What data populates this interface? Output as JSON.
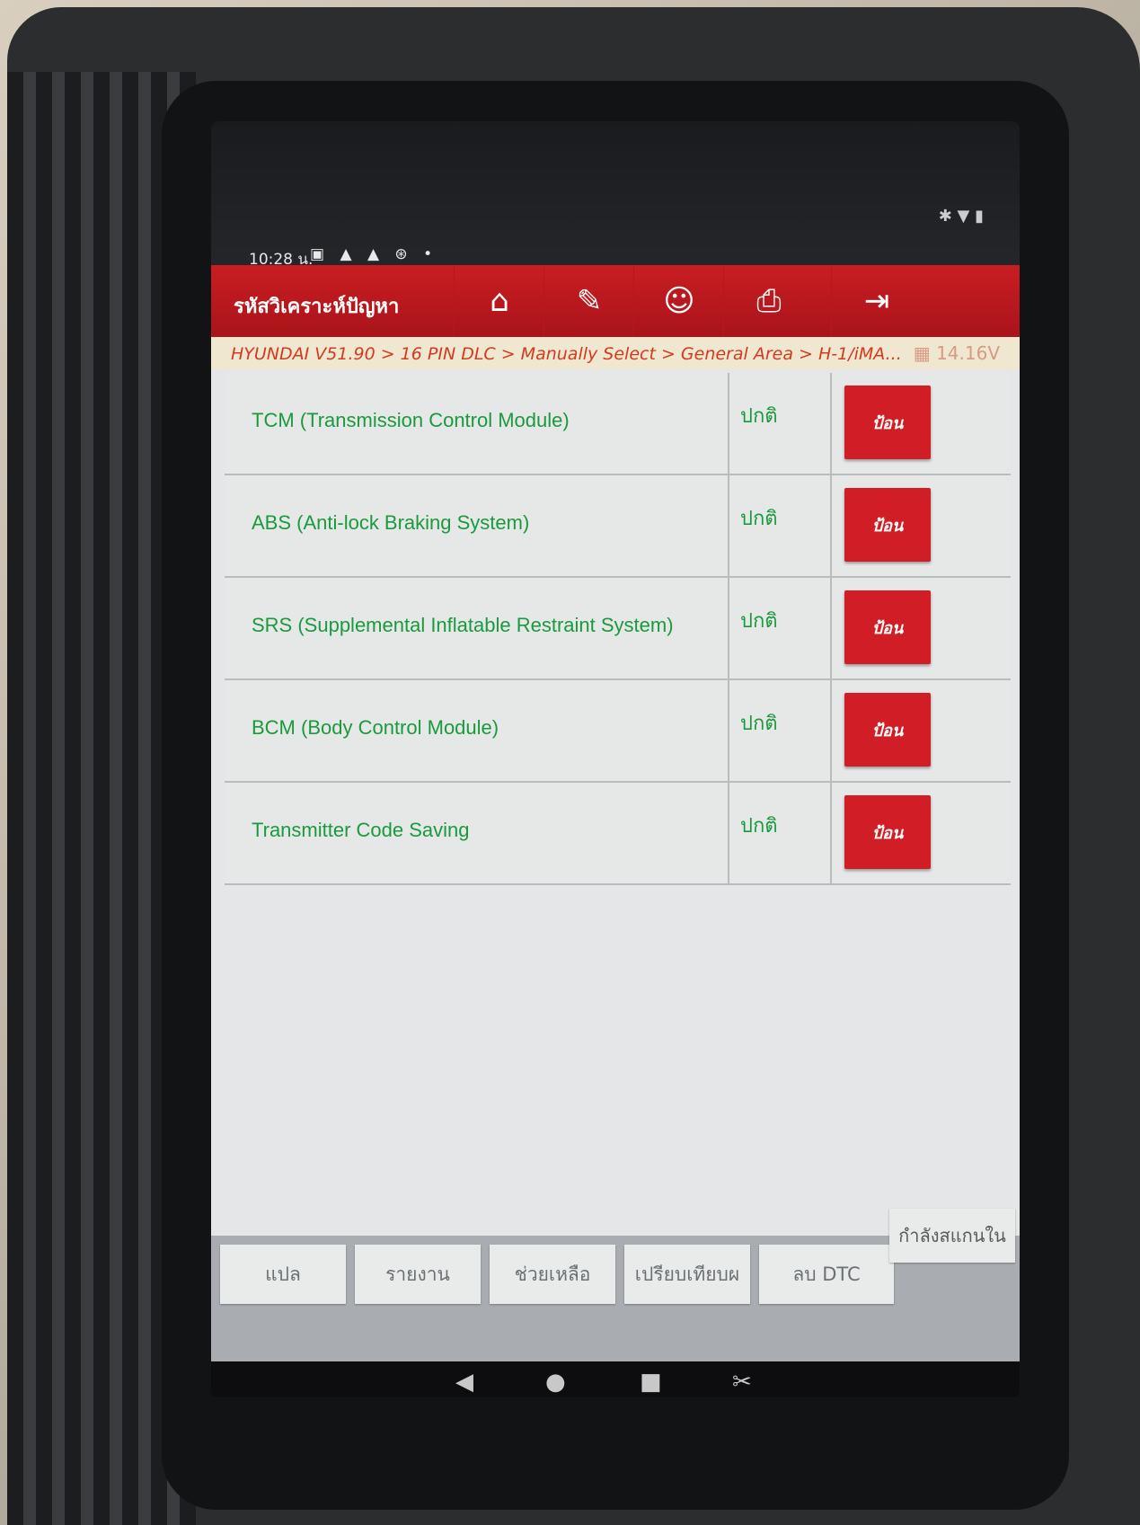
{
  "status_bar": {
    "time": "10:28 น.",
    "icons": [
      "calendar-icon",
      "warning-icon",
      "warning-icon",
      "settings-icon",
      "dot-icon"
    ],
    "icon_glyphs": "▣ ▲ ▲ ⊛ •",
    "system_glyphs": "✱ ▼ ▮"
  },
  "header": {
    "title": "รหัสวิเคราะห์ปัญหา",
    "buttons": [
      {
        "name": "home-icon",
        "glyph": "⌂"
      },
      {
        "name": "edit-icon",
        "glyph": "✎"
      },
      {
        "name": "user-icon",
        "glyph": "☺"
      },
      {
        "name": "print-icon",
        "glyph": "⎙"
      },
      {
        "name": "exit-icon",
        "glyph": "⇥"
      }
    ]
  },
  "breadcrumb": "HYUNDAI V51.90 > 16 PIN DLC > Manually Select > General Area > H-1/iMA...",
  "voltage": "14.16V",
  "systems": [
    {
      "name": "TCM (Transmission Control Module)",
      "status": "ปกติ",
      "button": "ป้อน"
    },
    {
      "name": "ABS (Anti-lock Braking System)",
      "status": "ปกติ",
      "button": "ป้อน"
    },
    {
      "name": "SRS (Supplemental Inflatable Restraint System)",
      "status": "ปกติ",
      "button": "ป้อน"
    },
    {
      "name": "BCM (Body Control Module)",
      "status": "ปกติ",
      "button": "ป้อน"
    },
    {
      "name": "Transmitter Code Saving",
      "status": "ปกติ",
      "button": "ป้อน"
    }
  ],
  "footer": {
    "buttons": [
      "แปล",
      "รายงาน",
      "ช่วยเหลือ",
      "เปรียบเทียบผ",
      "ลบ DTC"
    ],
    "scan_button": "กำลังสแกนใน"
  },
  "nav_bar": {
    "back": "◀",
    "home": "●",
    "recent": "■",
    "screenshot": "✂"
  },
  "colors": {
    "accent": "#c91d22",
    "ok_text": "#1a9a3c",
    "breadcrumb": "#d43a1f"
  }
}
